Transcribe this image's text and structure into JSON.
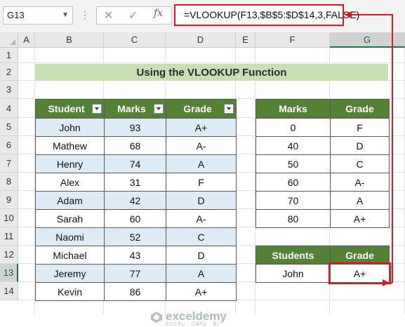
{
  "formula_bar": {
    "name_box": "G13",
    "fx": "fx",
    "formula": "=VLOOKUP(F13,$B$5:$D$14,3,FALSE)"
  },
  "columns": [
    "A",
    "B",
    "C",
    "D",
    "E",
    "F",
    "G"
  ],
  "selected_column": "G",
  "rows": [
    "1",
    "2",
    "3",
    "4",
    "5",
    "6",
    "7",
    "8",
    "9",
    "10",
    "11",
    "12",
    "13",
    "14"
  ],
  "selected_row": "13",
  "title": "Using the VLOOKUP Function",
  "main_table": {
    "headers": [
      "Student",
      "Marks",
      "Grade"
    ],
    "rows": [
      [
        "John",
        "93",
        "A+"
      ],
      [
        "Mathew",
        "68",
        "A-"
      ],
      [
        "Henry",
        "74",
        "A"
      ],
      [
        "Alex",
        "31",
        "F"
      ],
      [
        "Adam",
        "42",
        "D"
      ],
      [
        "Sarah",
        "60",
        "A-"
      ],
      [
        "Naomi",
        "52",
        "C"
      ],
      [
        "Michael",
        "43",
        "D"
      ],
      [
        "Jeremy",
        "77",
        "A"
      ],
      [
        "Kevin",
        "86",
        "A+"
      ]
    ]
  },
  "grade_table": {
    "headers": [
      "Marks",
      "Grade"
    ],
    "rows": [
      [
        "0",
        "F"
      ],
      [
        "40",
        "D"
      ],
      [
        "50",
        "C"
      ],
      [
        "60",
        "A-"
      ],
      [
        "70",
        "A"
      ],
      [
        "80",
        "A+"
      ]
    ]
  },
  "lookup_table": {
    "headers": [
      "Students",
      "Grade"
    ],
    "row": [
      "John",
      "A+"
    ]
  },
  "watermark": {
    "name": "exceldemy",
    "tagline": "EXCEL · DATA · BI"
  },
  "colors": {
    "header_green": "#548235",
    "title_green": "#c6e0b4",
    "stripe_blue": "#ddebf7",
    "highlight_red": "#e0151f"
  }
}
